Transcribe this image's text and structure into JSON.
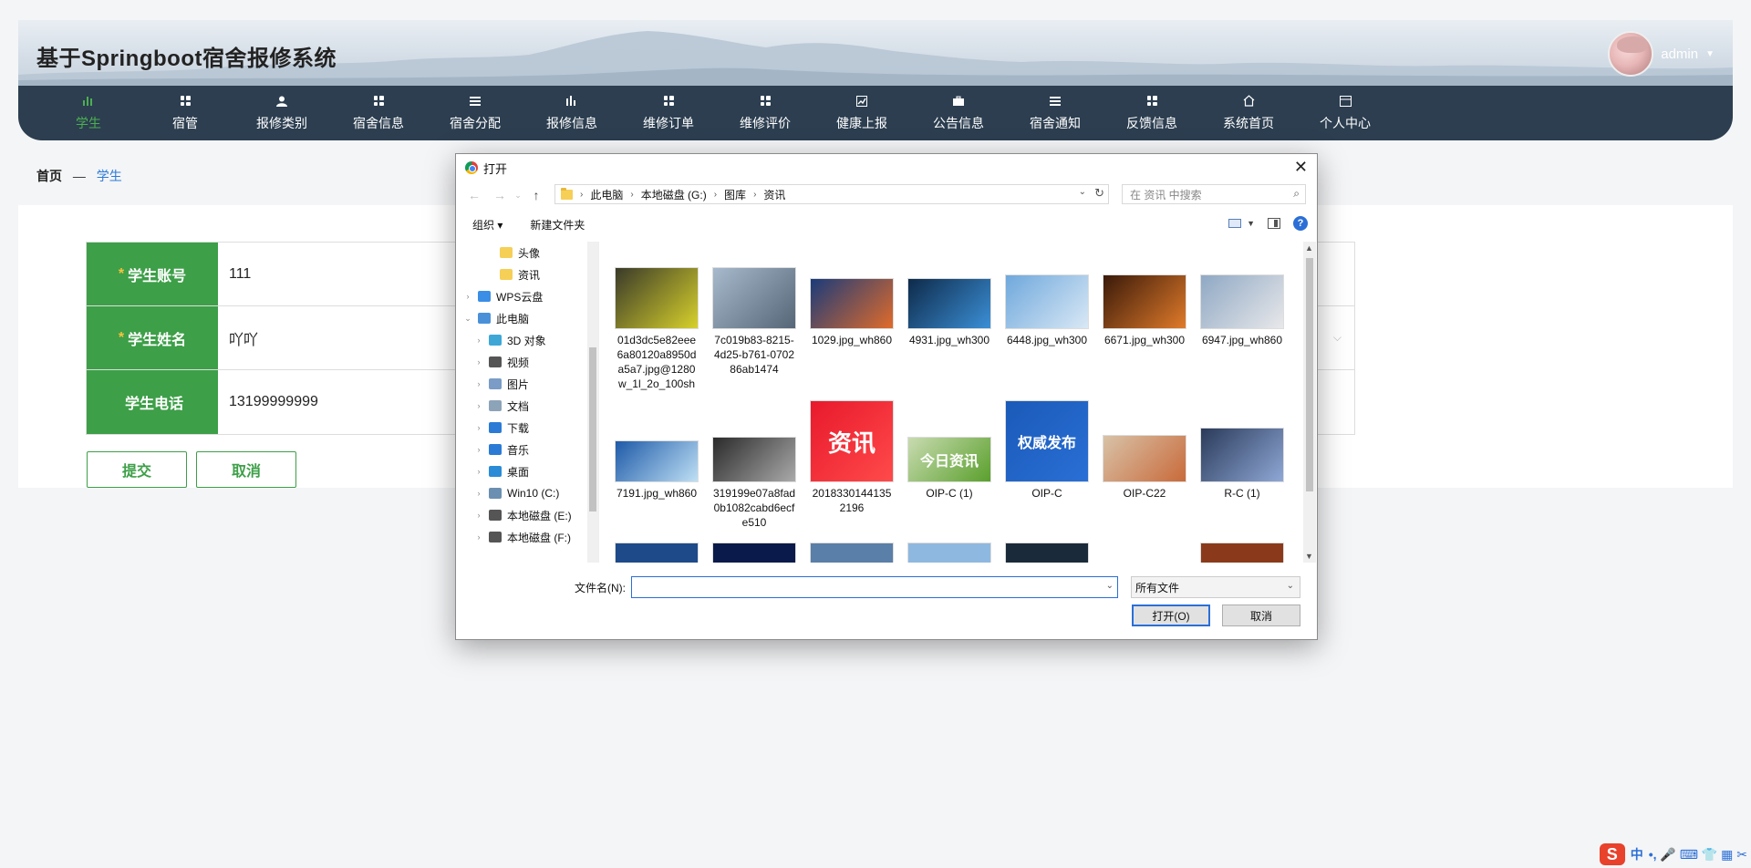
{
  "header": {
    "title": "基于Springboot宿舍报修系统",
    "username": "admin"
  },
  "nav": [
    {
      "label": "学生",
      "icon": "student-icon"
    },
    {
      "label": "宿管",
      "icon": "grid-icon"
    },
    {
      "label": "报修类别",
      "icon": "person-icon"
    },
    {
      "label": "宿舍信息",
      "icon": "grid-icon"
    },
    {
      "label": "宿舍分配",
      "icon": "list-icon"
    },
    {
      "label": "报修信息",
      "icon": "bar-chart-icon"
    },
    {
      "label": "维修订单",
      "icon": "grid-icon"
    },
    {
      "label": "维修评价",
      "icon": "grid-icon"
    },
    {
      "label": "健康上报",
      "icon": "chart-icon"
    },
    {
      "label": "公告信息",
      "icon": "briefcase-icon"
    },
    {
      "label": "宿舍通知",
      "icon": "list-icon"
    },
    {
      "label": "反馈信息",
      "icon": "grid-icon"
    },
    {
      "label": "系统首页",
      "icon": "home-icon"
    },
    {
      "label": "个人中心",
      "icon": "card-icon"
    }
  ],
  "breadcrumb": {
    "home": "首页",
    "sep": "—",
    "current": "学生"
  },
  "form": {
    "fields": [
      {
        "label": "学生账号",
        "required": "*",
        "value": "111"
      },
      {
        "label": "学生姓名",
        "required": "*",
        "value": "吖吖"
      },
      {
        "label": "学生电话",
        "required": "",
        "value": "13199999999"
      }
    ],
    "submit": "提交",
    "cancel": "取消"
  },
  "dialog": {
    "title": "打开",
    "path": [
      "此电脑",
      "本地磁盘 (G:)",
      "图库",
      "资讯"
    ],
    "search_placeholder": "在 资讯 中搜索",
    "organize": "组织 ▾",
    "new_folder": "新建文件夹",
    "tree": [
      {
        "label": "头像",
        "color": "#f6cf57",
        "indent": 2,
        "arrow": ""
      },
      {
        "label": "资讯",
        "color": "#f6cf57",
        "indent": 2,
        "arrow": ""
      },
      {
        "label": "WPS云盘",
        "color": "#3a8ee6",
        "indent": 0,
        "arrow": "›"
      },
      {
        "label": "此电脑",
        "color": "#4a90d9",
        "indent": 0,
        "arrow": "⌄"
      },
      {
        "label": "3D 对象",
        "color": "#3fa7d6",
        "indent": 1,
        "arrow": "›"
      },
      {
        "label": "视频",
        "color": "#555555",
        "indent": 1,
        "arrow": "›"
      },
      {
        "label": "图片",
        "color": "#7a9cc6",
        "indent": 1,
        "arrow": "›"
      },
      {
        "label": "文档",
        "color": "#8da3b8",
        "indent": 1,
        "arrow": "›"
      },
      {
        "label": "下载",
        "color": "#2b7bd6",
        "indent": 1,
        "arrow": "›"
      },
      {
        "label": "音乐",
        "color": "#2b7bd6",
        "indent": 1,
        "arrow": "›"
      },
      {
        "label": "桌面",
        "color": "#2b8bd6",
        "indent": 1,
        "arrow": "›"
      },
      {
        "label": "Win10 (C:)",
        "color": "#6b8fb0",
        "indent": 1,
        "arrow": "›"
      },
      {
        "label": "本地磁盘 (E:)",
        "color": "#555555",
        "indent": 1,
        "arrow": "›"
      },
      {
        "label": "本地磁盘 (F:)",
        "color": "#555555",
        "indent": 1,
        "arrow": "›"
      }
    ],
    "files_row1": [
      {
        "name": "01d3dc5e82eee6a80120a8950da5a7.jpg@1280w_1l_2o_100sh",
        "c1": "#3a3a2a",
        "c2": "#d7d12b"
      },
      {
        "name": "7c019b83-8215-4d25-b761-070286ab1474",
        "c1": "#a7b9cc",
        "c2": "#556677"
      },
      {
        "name": "1029.jpg_wh860",
        "c1": "#1a3b7a",
        "c2": "#e06b2a"
      },
      {
        "name": "4931.jpg_wh300",
        "c1": "#0e2a4a",
        "c2": "#3b8fd6"
      },
      {
        "name": "6448.jpg_wh300",
        "c1": "#6fa8dc",
        "c2": "#d9e8f5"
      },
      {
        "name": "6671.jpg_wh300",
        "c1": "#3a1a0a",
        "c2": "#e07a2a"
      },
      {
        "name": "6947.jpg_wh860",
        "c1": "#8fa8c4",
        "c2": "#e8e8ea"
      }
    ],
    "files_row2": [
      {
        "name": "7191.jpg_wh860",
        "c1": "#1e5aa8",
        "c2": "#bfe0f5"
      },
      {
        "name": "319199e07a8fad0b1082cabd6ecfe510",
        "c1": "#2a2a2a",
        "c2": "#aaaaaa"
      },
      {
        "name": "20183301441352196",
        "c1": "#e8192c",
        "c2": "#ff4a4a",
        "text": "资讯"
      },
      {
        "name": "OIP-C (1)",
        "c1": "#c9dbb1",
        "c2": "#5aa02c",
        "text": "今日资讯"
      },
      {
        "name": "OIP-C",
        "c1": "#1a5ab8",
        "c2": "#2a6fd6",
        "text": "权威发布"
      },
      {
        "name": "OIP-C22",
        "c1": "#d8c2a8",
        "c2": "#c96a3a"
      },
      {
        "name": "R-C (1)",
        "c1": "#2a3a5a",
        "c2": "#8fa8d6"
      }
    ],
    "filename_label": "文件名(N):",
    "filename_value": "",
    "filter": "所有文件",
    "open": "打开(O)",
    "cancel": "取消"
  },
  "tray": {
    "ime": "中",
    "symbols": "•, 🎤 ⌨ 👕 ▦ ✂"
  }
}
